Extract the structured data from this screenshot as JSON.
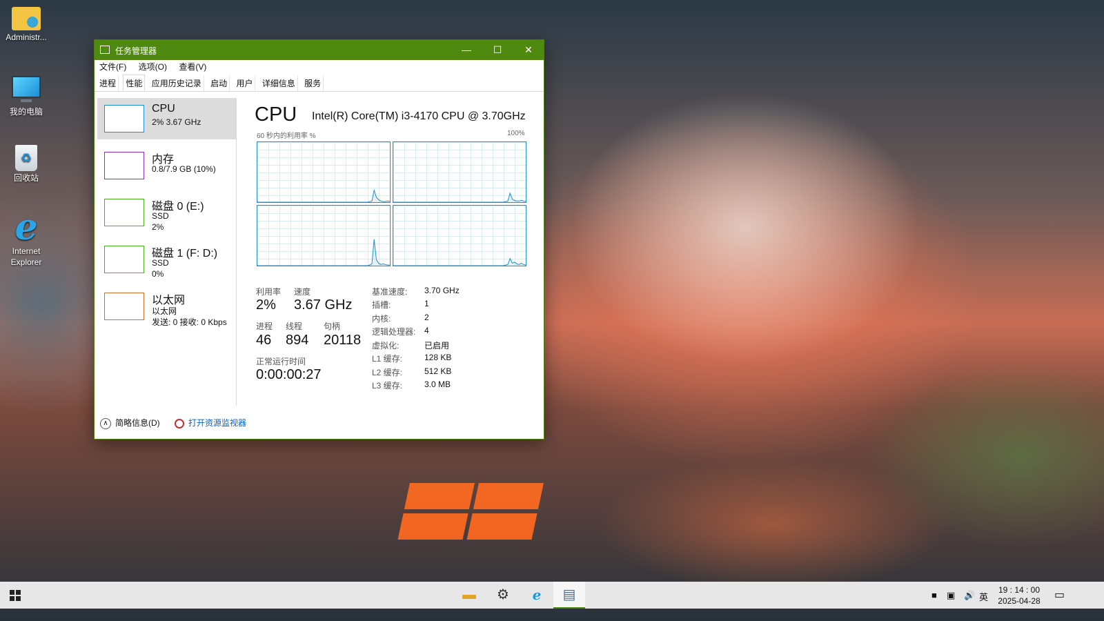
{
  "desktop": {
    "icons": [
      {
        "label": "Administr..."
      },
      {
        "label": "我的电脑"
      },
      {
        "label": "回收站"
      },
      {
        "label_line1": "Internet",
        "label_line2": "Explorer"
      }
    ]
  },
  "window": {
    "title": "任务管理器",
    "controls": {
      "minimize": "—",
      "maximize": "☐",
      "close": "✕"
    },
    "menu": [
      "文件(F)",
      "选项(O)",
      "查看(V)"
    ],
    "tabs": [
      "进程",
      "性能",
      "应用历史记录",
      "启动",
      "用户",
      "详细信息",
      "服务"
    ],
    "active_tab": "性能",
    "accent_color": "#4f8a10"
  },
  "sidebar": [
    {
      "name": "CPU",
      "line2": "2% 3.67 GHz",
      "line3": "",
      "color": "#1e90c8"
    },
    {
      "name": "内存",
      "line2": "0.8/7.9 GB (10%)",
      "line3": "",
      "color": "#8b2fc9"
    },
    {
      "name": "磁盘 0 (E:)",
      "line2": "SSD",
      "line3": "2%",
      "color": "#4caf1e"
    },
    {
      "name": "磁盘 1 (F: D:)",
      "line2": "SSD",
      "line3": "0%",
      "color": "#4caf1e"
    },
    {
      "name": "以太网",
      "line2": "以太网",
      "line3": "发送: 0 接收: 0 Kbps",
      "color": "#c8702a"
    }
  ],
  "cpu": {
    "title": "CPU",
    "model": "Intel(R) Core(TM) i3-4170 CPU @ 3.70GHz",
    "graph_caption": "60 秒内的利用率 %",
    "graph_max": "100%",
    "graphs": [
      {
        "points": [
          0,
          0,
          0,
          0,
          0,
          0,
          0,
          0,
          0,
          0,
          0,
          0,
          0,
          0,
          0,
          0,
          0,
          0,
          0,
          0,
          0,
          0,
          0,
          0,
          0,
          0,
          0,
          0,
          0,
          0,
          0,
          0,
          0,
          0,
          0,
          0,
          0,
          0,
          0,
          0,
          0,
          0,
          0,
          0,
          0,
          0,
          0,
          0,
          0,
          0,
          1,
          2,
          20,
          8,
          4,
          2,
          1,
          1,
          2,
          1
        ]
      },
      {
        "points": [
          0,
          0,
          0,
          0,
          0,
          0,
          0,
          0,
          0,
          0,
          0,
          0,
          0,
          0,
          0,
          0,
          0,
          0,
          0,
          0,
          0,
          0,
          0,
          0,
          0,
          0,
          0,
          0,
          0,
          0,
          0,
          0,
          0,
          0,
          0,
          0,
          0,
          0,
          0,
          0,
          0,
          0,
          0,
          0,
          0,
          0,
          0,
          0,
          0,
          0,
          1,
          2,
          15,
          5,
          3,
          2,
          2,
          3,
          2,
          1
        ]
      },
      {
        "points": [
          0,
          0,
          0,
          0,
          0,
          0,
          0,
          0,
          0,
          0,
          0,
          0,
          0,
          0,
          0,
          0,
          0,
          0,
          0,
          0,
          0,
          0,
          0,
          0,
          0,
          0,
          0,
          0,
          0,
          0,
          0,
          0,
          0,
          0,
          0,
          0,
          0,
          0,
          0,
          0,
          0,
          0,
          0,
          0,
          0,
          0,
          0,
          0,
          0,
          0,
          1,
          3,
          44,
          10,
          4,
          2,
          3,
          2,
          1,
          1
        ]
      },
      {
        "points": [
          0,
          0,
          0,
          0,
          0,
          0,
          0,
          0,
          0,
          0,
          0,
          0,
          0,
          0,
          0,
          0,
          0,
          0,
          0,
          0,
          0,
          0,
          0,
          0,
          0,
          0,
          0,
          0,
          0,
          0,
          0,
          0,
          0,
          0,
          0,
          0,
          0,
          0,
          0,
          0,
          0,
          0,
          0,
          0,
          0,
          0,
          0,
          0,
          0,
          0,
          1,
          2,
          12,
          4,
          6,
          3,
          2,
          4,
          2,
          1
        ]
      }
    ],
    "stats": {
      "utilization_label": "利用率",
      "utilization": "2%",
      "speed_label": "速度",
      "speed": "3.67 GHz",
      "processes_label": "进程",
      "processes": "46",
      "threads_label": "线程",
      "threads": "894",
      "handles_label": "句柄",
      "handles": "20118",
      "uptime_label": "正常运行时间",
      "uptime": "0:00:00:27"
    },
    "specs": [
      {
        "k": "基准速度:",
        "v": "3.70 GHz"
      },
      {
        "k": "插槽:",
        "v": "1"
      },
      {
        "k": "内核:",
        "v": "2"
      },
      {
        "k": "逻辑处理器:",
        "v": "4"
      },
      {
        "k": "虚拟化:",
        "v": "已启用"
      },
      {
        "k": "L1 缓存:",
        "v": "128 KB"
      },
      {
        "k": "L2 缓存:",
        "v": "512 KB"
      },
      {
        "k": "L3 缓存:",
        "v": "3.0 MB"
      }
    ]
  },
  "footer": {
    "fewer_details": "简略信息(D)",
    "resource_monitor": "打开资源监视器"
  },
  "taskbar": {
    "apps": [
      "file-explorer-icon",
      "settings-gear-icon",
      "internet-explorer-icon",
      "task-manager-icon"
    ],
    "tray": {
      "input_method": "英"
    },
    "time": "19 : 14 : 00",
    "date": "2025-04-28"
  }
}
